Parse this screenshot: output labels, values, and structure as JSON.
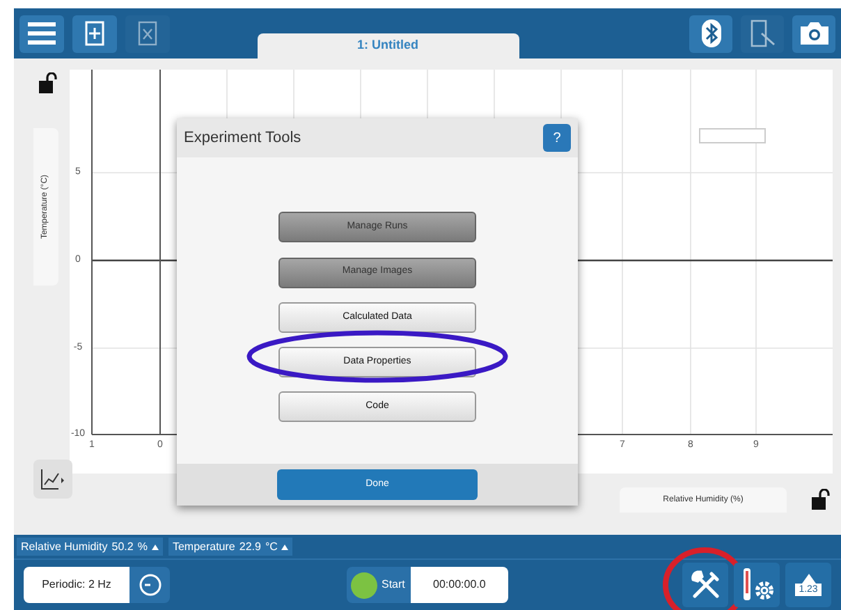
{
  "toolbar": {
    "buttons": [
      {
        "kind": "menu",
        "disabled": false
      },
      {
        "kind": "new-file",
        "disabled": false
      },
      {
        "kind": "close-file",
        "disabled": true
      }
    ],
    "right_buttons": [
      {
        "kind": "bluetooth",
        "disabled": false
      },
      {
        "kind": "report",
        "disabled": true
      },
      {
        "kind": "camera",
        "disabled": false
      }
    ]
  },
  "tabs": [
    {
      "label": "1: Untitled",
      "selected": true
    }
  ],
  "graph": {
    "y_label": "Temperature (°C)",
    "x_label": "Relative Humidity (%)",
    "y_ticks": [
      "5",
      "0",
      "-5",
      "-10"
    ],
    "x_ticks": [
      "1",
      "0",
      "7",
      "8",
      "9"
    ]
  },
  "dialog": {
    "title": "Experiment Tools",
    "help": "?",
    "items": [
      {
        "label": "Manage Runs",
        "disabled": true,
        "circled": false
      },
      {
        "label": "Manage Images",
        "disabled": true,
        "circled": false
      },
      {
        "label": "Calculated Data",
        "disabled": false,
        "circled": false
      },
      {
        "label": "Data Properties",
        "disabled": false,
        "circled": true
      },
      {
        "label": "Code",
        "disabled": false,
        "circled": false
      }
    ],
    "done": "Done"
  },
  "sensors": [
    {
      "name": "Relative Humidity",
      "value": "50.2",
      "unit": "%"
    },
    {
      "name": "Temperature",
      "value": "22.9",
      "unit": "°C"
    }
  ],
  "collection": {
    "mode": "Periodic: 2 Hz",
    "start": "Start",
    "time": "00:00:00.0"
  },
  "bottom_tools": [
    {
      "kind": "tools",
      "circled": true
    },
    {
      "kind": "sensor-settings",
      "circled": false
    },
    {
      "kind": "meter",
      "label": "1.23",
      "circled": false
    }
  ]
}
